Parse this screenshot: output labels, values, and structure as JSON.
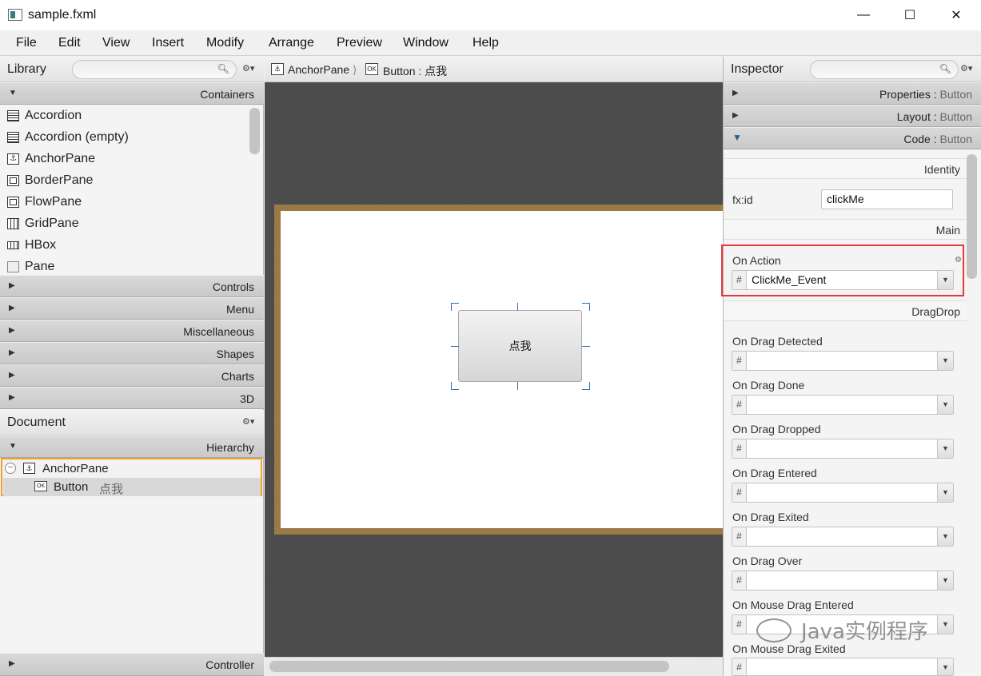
{
  "window": {
    "title": "sample.fxml",
    "min_glyph": "—",
    "max_glyph": "☐",
    "close_glyph": "✕"
  },
  "menu": [
    "File",
    "Edit",
    "View",
    "Insert",
    "Modify",
    "Arrange",
    "Preview",
    "Window",
    "Help"
  ],
  "library": {
    "title": "Library",
    "gear": "⚙▾",
    "sections": {
      "containers": "Containers",
      "controls": "Controls",
      "menu": "Menu",
      "misc": "Miscellaneous",
      "shapes": "Shapes",
      "charts": "Charts",
      "threed": "3D"
    },
    "items": [
      "Accordion",
      "Accordion  (empty)",
      "AnchorPane",
      "BorderPane",
      "FlowPane",
      "GridPane",
      "HBox",
      "Pane"
    ]
  },
  "document": {
    "title": "Document",
    "gear": "⚙▾",
    "hierarchy_label": "Hierarchy",
    "tree": {
      "root": "AnchorPane",
      "child_type": "Button",
      "child_text": "点我"
    },
    "controller_label": "Controller"
  },
  "breadcrumb": {
    "first": "AnchorPane",
    "second": "Button : 点我"
  },
  "canvas": {
    "button_text": "点我"
  },
  "inspector": {
    "title": "Inspector",
    "gear": "⚙▾",
    "sections": [
      {
        "key": "Properties",
        "value": "Button"
      },
      {
        "key": "Layout",
        "value": "Button"
      },
      {
        "key": "Code",
        "value": "Button"
      }
    ],
    "identity_label": "Identity",
    "fxid_label": "fx:id",
    "fxid_value": "clickMe",
    "main_label": "Main",
    "on_action_label": "On Action",
    "on_action_value": "ClickMe_Event",
    "dragdrop_label": "DragDrop",
    "events": [
      "On Drag Detected",
      "On Drag Done",
      "On Drag Dropped",
      "On Drag Entered",
      "On Drag Exited",
      "On Drag Over",
      "On Mouse Drag Entered",
      "On Mouse Drag Exited"
    ]
  },
  "watermark": "Java实例程序"
}
